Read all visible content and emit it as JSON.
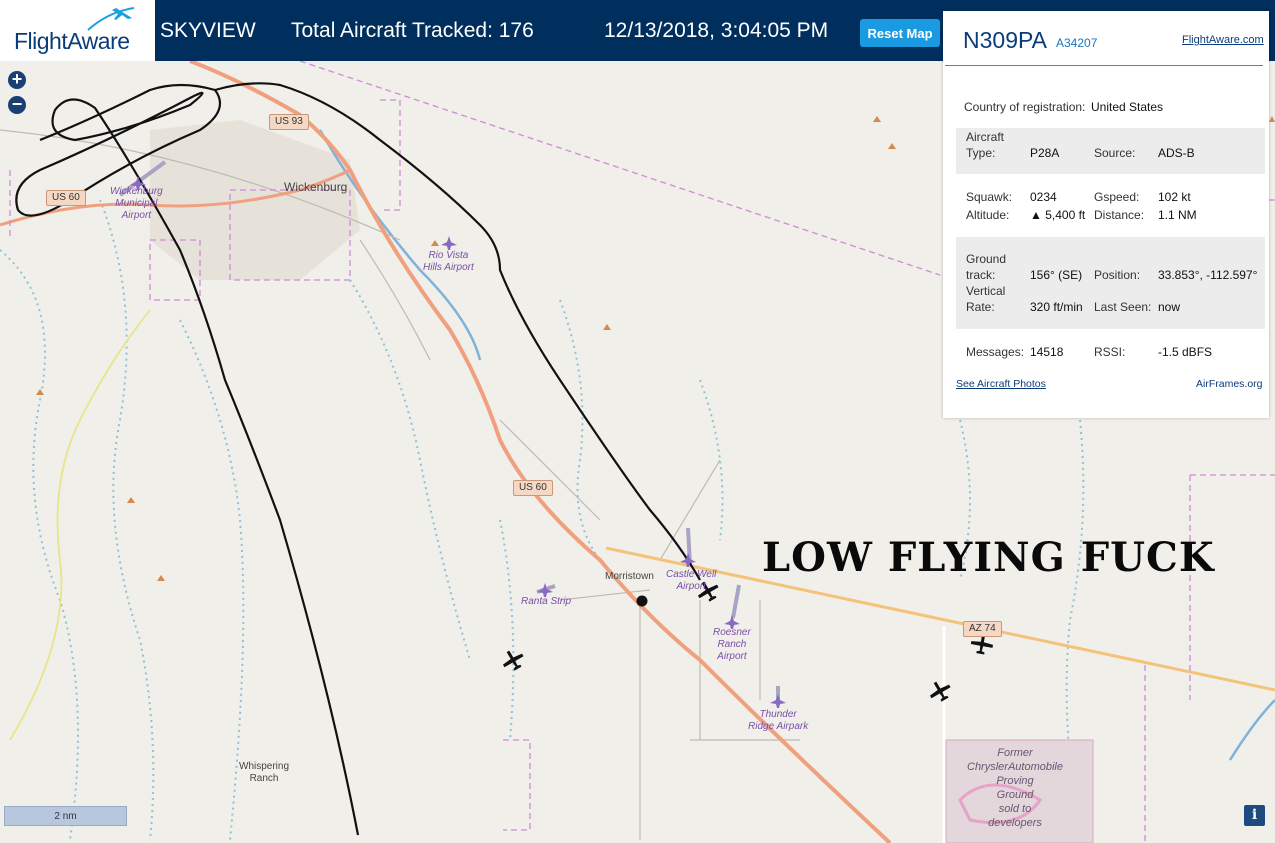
{
  "header": {
    "logo_text": "FlightAware",
    "app_title": "SKYVIEW",
    "aircraft_tracked": "Total Aircraft Tracked: 176",
    "datetime": "12/13/2018, 3:04:05 PM",
    "reset_label": "Reset Map"
  },
  "zoom": {
    "in_label": "+",
    "out_label": "−"
  },
  "panel": {
    "registration": "N309PA",
    "hex": "A34207",
    "fa_link": "FlightAware.com",
    "country_label": "Country of registration:",
    "country_value": "United States",
    "rows": {
      "aircraft_type_label_1": "Aircraft",
      "aircraft_type_label_2": "Type:",
      "aircraft_type_value": "P28A",
      "source_label": "Source:",
      "source_value": "ADS-B",
      "squawk_label": "Squawk:",
      "squawk_value": "0234",
      "gspeed_label": "Gspeed:",
      "gspeed_value": "102 kt",
      "altitude_label": "Altitude:",
      "altitude_value": "▲ 5,400 ft",
      "distance_label": "Distance:",
      "distance_value": "1.1 NM",
      "ground_track_label_1": "Ground",
      "ground_track_label_2": "track:",
      "ground_track_value": "156° (SE)",
      "position_label": "Position:",
      "position_value": "33.853°, -112.597°",
      "vertical_rate_label_1": "Vertical",
      "vertical_rate_label_2": "Rate:",
      "vertical_rate_value": "320 ft/min",
      "last_seen_label": "Last Seen:",
      "last_seen_value": "now",
      "messages_label": "Messages:",
      "messages_value": "14518",
      "rssi_label": "RSSI:",
      "rssi_value": "-1.5 dBFS"
    },
    "photos_link": "See Aircraft Photos",
    "airframes_link": "AirFrames.org"
  },
  "map": {
    "towns": {
      "wickenburg": "Wickenburg",
      "morristown": "Morristown",
      "whispering_ranch_1": "Whispering",
      "whispering_ranch_2": "Ranch"
    },
    "airports": {
      "wickenburg_1": "Wickenburg",
      "wickenburg_2": "Municipal",
      "wickenburg_3": "Airport",
      "rio_vista_1": "Rio Vista",
      "rio_vista_2": "Hills Airport",
      "castle_well_1": "Castle Well",
      "castle_well_2": "Airport",
      "ranta_strip": "Ranta Strip",
      "roesner_1": "Roesner",
      "roesner_2": "Ranch",
      "roesner_3": "Airport",
      "thunder_1": "Thunder",
      "thunder_2": "Ridge Airpark"
    },
    "proving_ground": {
      "l1": "Former",
      "l2": "ChryslerAutomobile",
      "l3": "Proving",
      "l4": "Ground",
      "l5": "sold to",
      "l6": "developers"
    },
    "road_shields": {
      "us93": "US 93",
      "us60_west": "US 60",
      "us60_center": "US 60",
      "az74": "AZ 74"
    },
    "scale_label": "2 nm",
    "info_label": "i"
  },
  "caption": "LOW FLYING FUCK",
  "colors": {
    "header_bg": "#002f5d",
    "button_bg": "#1a9ae0",
    "highway": "#f0a07e",
    "state_route": "#f5c27a",
    "flight_track": "#111111"
  }
}
